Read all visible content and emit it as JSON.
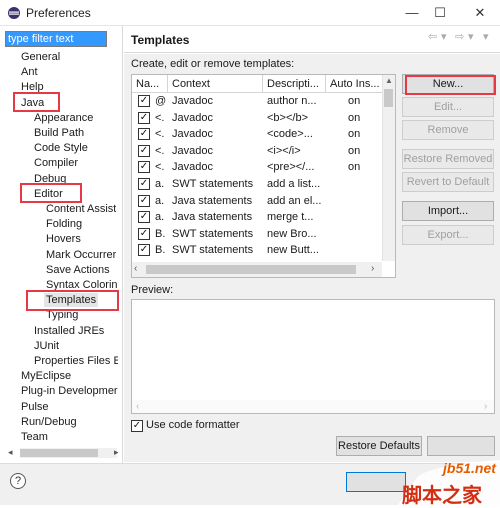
{
  "window": {
    "title": "Preferences",
    "minimize_symbol": "—",
    "maximize_symbol": "☐",
    "close_symbol": "✕"
  },
  "filter": {
    "value": "type filter text"
  },
  "tree": [
    {
      "label": "General",
      "level": 0
    },
    {
      "label": "Ant",
      "level": 0
    },
    {
      "label": "Help",
      "level": 0
    },
    {
      "label": "Java",
      "level": 0
    },
    {
      "label": "Appearance",
      "level": 1
    },
    {
      "label": "Build Path",
      "level": 1
    },
    {
      "label": "Code Style",
      "level": 1
    },
    {
      "label": "Compiler",
      "level": 1
    },
    {
      "label": "Debug",
      "level": 1
    },
    {
      "label": "Editor",
      "level": 1
    },
    {
      "label": "Content Assist",
      "level": 2
    },
    {
      "label": "Folding",
      "level": 2
    },
    {
      "label": "Hovers",
      "level": 2
    },
    {
      "label": "Mark Occurrer",
      "level": 2
    },
    {
      "label": "Save Actions",
      "level": 2
    },
    {
      "label": "Syntax Colorin",
      "level": 2
    },
    {
      "label": "Templates",
      "level": 2,
      "selected": true
    },
    {
      "label": "Typing",
      "level": 2
    },
    {
      "label": "Installed JREs",
      "level": 1
    },
    {
      "label": "JUnit",
      "level": 1
    },
    {
      "label": "Properties Files E",
      "level": 1
    },
    {
      "label": "MyEclipse",
      "level": 0
    },
    {
      "label": "Plug-in Developmer",
      "level": 0
    },
    {
      "label": "Pulse",
      "level": 0
    },
    {
      "label": "Run/Debug",
      "level": 0
    },
    {
      "label": "Team",
      "level": 0
    }
  ],
  "page": {
    "title": "Templates",
    "description": "Create, edit or remove templates:",
    "back_icon": "⇦",
    "forward_icon": "⇨",
    "menu_icon": "▾"
  },
  "table": {
    "columns": [
      "Na...",
      "Context",
      "Descripti...",
      "Auto Ins..."
    ],
    "rows": [
      {
        "checked": true,
        "name": "@",
        "context": "Javadoc",
        "description": "author n...",
        "auto": "on"
      },
      {
        "checked": true,
        "name": "<.",
        "context": "Javadoc",
        "description": "<b></b>",
        "auto": "on"
      },
      {
        "checked": true,
        "name": "<.",
        "context": "Javadoc",
        "description": "<code>...",
        "auto": "on"
      },
      {
        "checked": true,
        "name": "<.",
        "context": "Javadoc",
        "description": "<i></i>",
        "auto": "on"
      },
      {
        "checked": true,
        "name": "<.",
        "context": "Javadoc",
        "description": "<pre></...",
        "auto": "on"
      },
      {
        "checked": true,
        "name": "a.",
        "context": "SWT statements",
        "description": "add a list...",
        "auto": ""
      },
      {
        "checked": true,
        "name": "a.",
        "context": "Java statements",
        "description": "add an el...",
        "auto": ""
      },
      {
        "checked": true,
        "name": "a.",
        "context": "Java statements",
        "description": "merge t...",
        "auto": ""
      },
      {
        "checked": true,
        "name": "B.",
        "context": "SWT statements",
        "description": "new Bro...",
        "auto": ""
      },
      {
        "checked": true,
        "name": "B.",
        "context": "SWT statements",
        "description": "new Butt...",
        "auto": ""
      }
    ]
  },
  "buttons": {
    "new": "New...",
    "edit": "Edit...",
    "remove": "Remove",
    "restore_removed": "Restore Removed",
    "revert": "Revert to Default",
    "import": "Import...",
    "export": "Export..."
  },
  "preview": {
    "label": "Preview:"
  },
  "formatter": {
    "label": "Use code formatter",
    "checked": true
  },
  "footer": {
    "restore_defaults": "Restore Defaults",
    "help_symbol": "?"
  },
  "watermark": {
    "top": "jb51.net",
    "bottom": "脚本之家"
  },
  "colors": {
    "highlight": "#e63946",
    "selection": "#3399ff"
  }
}
